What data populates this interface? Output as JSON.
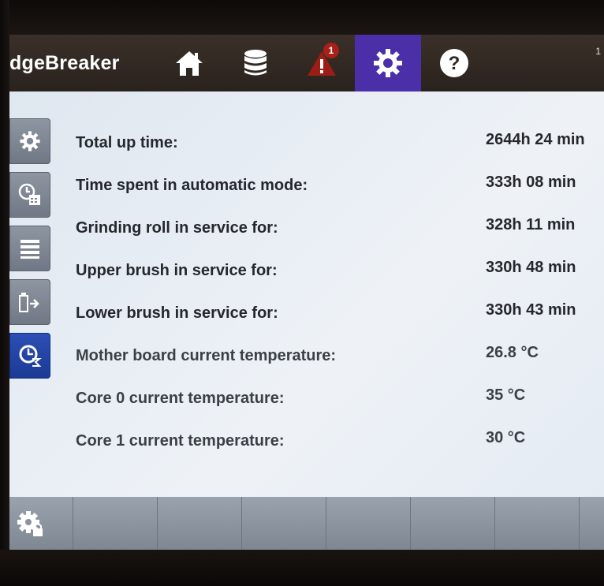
{
  "header": {
    "brand": "dgeBreaker",
    "corner_number": "1",
    "nav": [
      {
        "name": "home",
        "icon": "home-icon"
      },
      {
        "name": "database",
        "icon": "database-icon"
      },
      {
        "name": "alarm",
        "icon": "warning-icon",
        "badge": "1"
      },
      {
        "name": "settings",
        "icon": "gear-icon",
        "active": true
      },
      {
        "name": "help",
        "icon": "help-icon"
      }
    ]
  },
  "sidebar": {
    "tabs": [
      {
        "icon": "gear-icon"
      },
      {
        "icon": "clock-calendar-icon"
      },
      {
        "icon": "list-icon"
      },
      {
        "icon": "usb-export-icon"
      },
      {
        "icon": "clock-sigma-icon",
        "active": true
      }
    ]
  },
  "stats": [
    {
      "label": "Total up time:",
      "value": "2644h 24 min"
    },
    {
      "label": "Time spent in automatic mode:",
      "value": "333h 08 min"
    },
    {
      "label": "Grinding roll in service for:",
      "value": "328h 11 min"
    },
    {
      "label": "Upper brush in service for:",
      "value": "330h 48 min"
    },
    {
      "label": "Lower brush in service for:",
      "value": "330h 43 min"
    },
    {
      "label": "Mother board current temperature:",
      "value": "26.8 °C"
    },
    {
      "label": "Core 0 current temperature:",
      "value": "35 °C"
    },
    {
      "label": "Core 1 current temperature:",
      "value": "30 °C"
    }
  ],
  "footer": {
    "icons": [
      "gear-lock-icon"
    ]
  },
  "colors": {
    "topbar": "#2f2620",
    "active_nav": "#4b2fa8",
    "content_bg": "#e6edf4",
    "active_tab": "#1f3f9c",
    "bottombar": "#8a939d"
  }
}
